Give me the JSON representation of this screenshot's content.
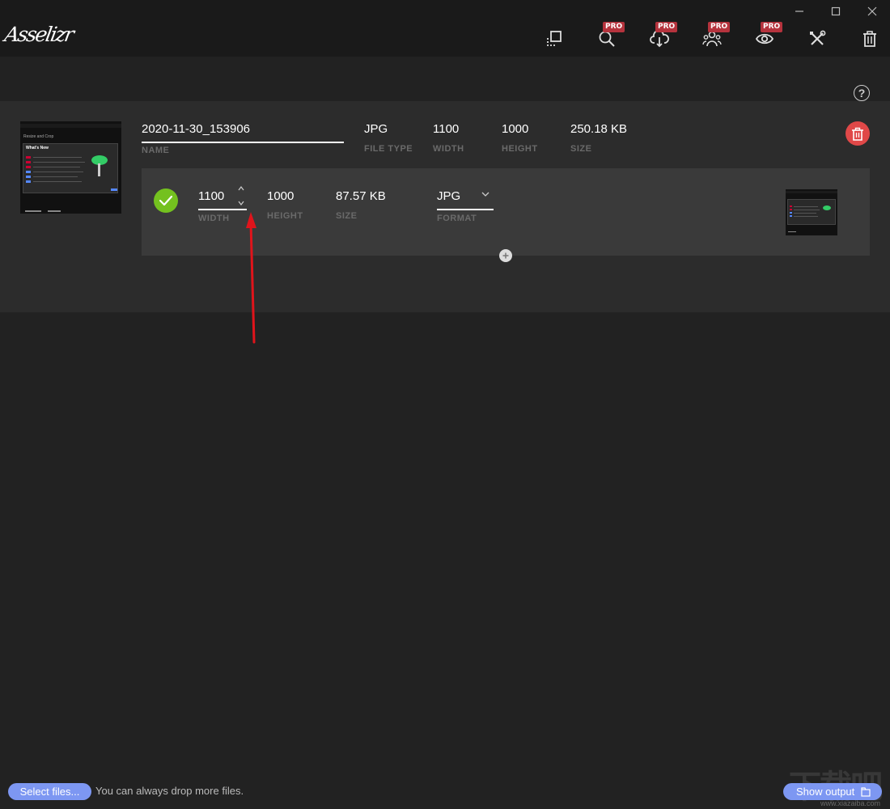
{
  "app": {
    "logo_text": "Asselizr"
  },
  "window_controls": {
    "minimize": "—",
    "maximize": "☐",
    "close": "✕"
  },
  "toolbar": {
    "pro_label": "PRO",
    "icons": [
      "resize-icon",
      "search-icon",
      "cloud-download-icon",
      "users-icon",
      "eye-icon",
      "tools-icon",
      "trash-icon"
    ]
  },
  "help": {
    "label": "?"
  },
  "file": {
    "name_value": "2020-11-30_153906",
    "name_label": "NAME",
    "file_type_value": "JPG",
    "file_type_label": "FILE TYPE",
    "width_value": "1100",
    "width_label": "WIDTH",
    "height_value": "1000",
    "height_label": "HEIGHT",
    "size_value": "250.18 KB",
    "size_label": "SIZE"
  },
  "output": {
    "width_value": "1100",
    "width_label": "WIDTH",
    "height_value": "1000",
    "height_label": "HEIGHT",
    "size_value": "87.57 KB",
    "size_label": "SIZE",
    "format_value": "JPG",
    "format_label": "FORMAT"
  },
  "thumbnail_text": {
    "heading": "Resize and Crop",
    "whats_new": "What's New"
  },
  "bottom": {
    "select_files_label": "Select files...",
    "drop_hint": "You can always drop more files.",
    "show_output_label": "Show output"
  },
  "watermark": {
    "big": "下载吧",
    "small": "www.xiazaiba.com"
  },
  "colors": {
    "background": "#222222",
    "panel": "#2c2c2c",
    "row": "#3a3a3a",
    "accent_blue": "#7d97f2",
    "pro_red": "#b5333d",
    "delete_red": "#e04848",
    "success_green": "#74c11f",
    "arrow_red": "#e0141b"
  }
}
